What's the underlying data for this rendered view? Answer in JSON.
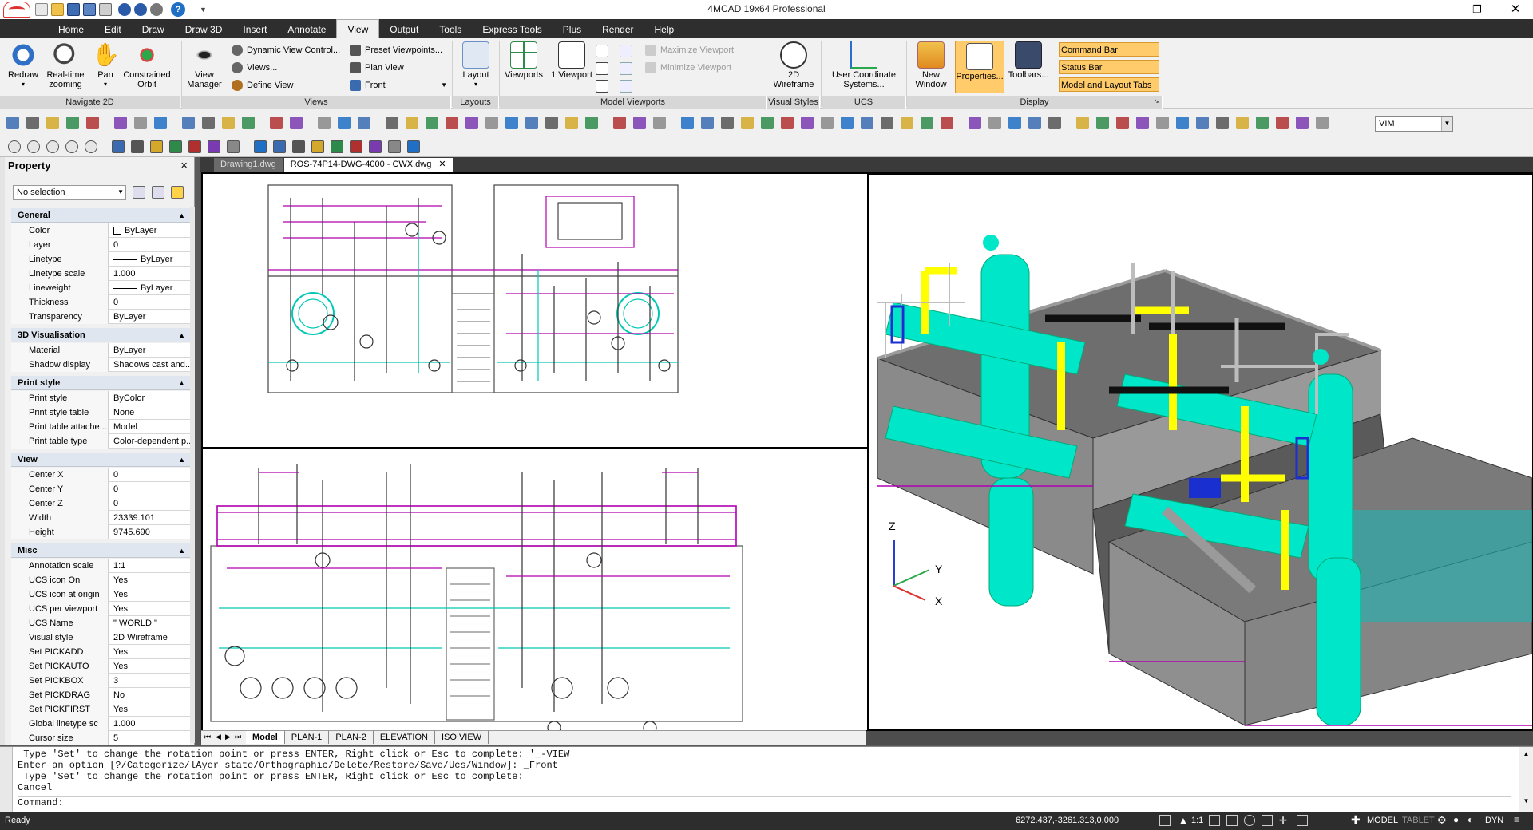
{
  "app": {
    "title": "4MCAD 19x64 Professional"
  },
  "quick_access": {
    "help_label": "?"
  },
  "menu": [
    "Home",
    "Edit",
    "Draw",
    "Draw 3D",
    "Insert",
    "Annotate",
    "View",
    "Output",
    "Tools",
    "Express Tools",
    "Plus",
    "Render",
    "Help"
  ],
  "ribbon": {
    "navigate": {
      "group": "Navigate 2D",
      "redraw": "Redraw",
      "realtime": "Real-time zooming",
      "pan": "Pan",
      "orbit": "Constrained Orbit"
    },
    "views": {
      "group": "Views",
      "view_manager": "View Manager",
      "dynamic": "Dynamic View Control...",
      "views": "Views...",
      "define": "Define View",
      "preset": "Preset Viewpoints...",
      "plan": "Plan View",
      "front": "Front"
    },
    "layouts": {
      "group": "Layouts",
      "layout": "Layout"
    },
    "model_viewports": {
      "group": "Model Viewports",
      "viewports": "Viewports",
      "one": "1 Viewport",
      "maximize": "Maximize Viewport",
      "minimize": "Minimize Viewport"
    },
    "visual_styles": {
      "group": "Visual Styles",
      "wireframe": "2D Wireframe"
    },
    "ucs": {
      "group": "UCS",
      "label": "User Coordinate Systems..."
    },
    "display": {
      "group": "Display",
      "new_window": "New Window",
      "properties": "Properties...",
      "toolbars": "Toolbars...",
      "command_bar": "Command Bar",
      "status_bar": "Status Bar",
      "model_layout_tabs": "Model and Layout Tabs"
    }
  },
  "toolbar": {
    "vim_value": "VIM"
  },
  "property": {
    "title": "Property",
    "selection": "No selection",
    "sections": [
      {
        "name": "General",
        "rows": [
          [
            "Color",
            "ByLayer"
          ],
          [
            "Layer",
            "0"
          ],
          [
            "Linetype",
            "ByLayer"
          ],
          [
            "Linetype scale",
            "1.000"
          ],
          [
            "Lineweight",
            "ByLayer"
          ],
          [
            "Thickness",
            "0"
          ],
          [
            "Transparency",
            "ByLayer"
          ]
        ]
      },
      {
        "name": "3D Visualisation",
        "rows": [
          [
            "Material",
            "ByLayer"
          ],
          [
            "Shadow display",
            "Shadows cast and..."
          ]
        ]
      },
      {
        "name": "Print style",
        "rows": [
          [
            "Print style",
            "ByColor"
          ],
          [
            "Print style table",
            "None"
          ],
          [
            "Print table attache...",
            "Model"
          ],
          [
            "Print table type",
            "Color-dependent p..."
          ]
        ]
      },
      {
        "name": "View",
        "rows": [
          [
            "Center X",
            "0"
          ],
          [
            "Center Y",
            "0"
          ],
          [
            "Center Z",
            "0"
          ],
          [
            "Width",
            "23339.101"
          ],
          [
            "Height",
            "9745.690"
          ]
        ]
      },
      {
        "name": "Misc",
        "rows": [
          [
            "Annotation scale",
            "1:1"
          ],
          [
            "UCS icon On",
            "Yes"
          ],
          [
            "UCS icon at origin",
            "Yes"
          ],
          [
            "UCS per viewport",
            "Yes"
          ],
          [
            "UCS Name",
            "\" WORLD \""
          ],
          [
            "Visual style",
            "2D Wireframe"
          ],
          [
            "Set PICKADD",
            "Yes"
          ],
          [
            "Set PICKAUTO",
            "Yes"
          ],
          [
            "Set PICKBOX",
            "3"
          ],
          [
            "Set PICKDRAG",
            "No"
          ],
          [
            "Set PICKFIRST",
            "Yes"
          ],
          [
            "Global linetype sc",
            "1.000"
          ],
          [
            "Cursor size",
            "5"
          ]
        ]
      }
    ]
  },
  "documents": {
    "tabs": [
      "Drawing1.dwg",
      "ROS-74P14-DWG-4000 - CWX.dwg"
    ],
    "active": 1
  },
  "layout_tabs": [
    "Model",
    "PLAN-1",
    "PLAN-2",
    "ELEVATION",
    "ISO VIEW"
  ],
  "ucs_icon": {
    "z": "Z",
    "y": "Y",
    "x": "X"
  },
  "command": {
    "history": [
      " Type 'Set' to change the rotation point or press ENTER, Right click or Esc to complete: '_-VIEW",
      "Enter an option [?/Categorize/lAyer state/Orthographic/Delete/Restore/Save/Ucs/Window]: _Front",
      " Type 'Set' to change the rotation point or press ENTER, Right click or Esc to complete:",
      "Cancel"
    ],
    "prompt": "Command:"
  },
  "status": {
    "ready": "Ready",
    "coords": "6272.437,-3261.313,0.000",
    "scale": "1:1",
    "model": "MODEL",
    "tablet": "TABLET",
    "dyn": "DYN"
  },
  "colors": {
    "accent_orange": "#ffcb6b",
    "menubar": "#2e2e2e",
    "cyan": "#00e6c8",
    "magenta": "#b000b0",
    "yellow": "#ffff00"
  }
}
